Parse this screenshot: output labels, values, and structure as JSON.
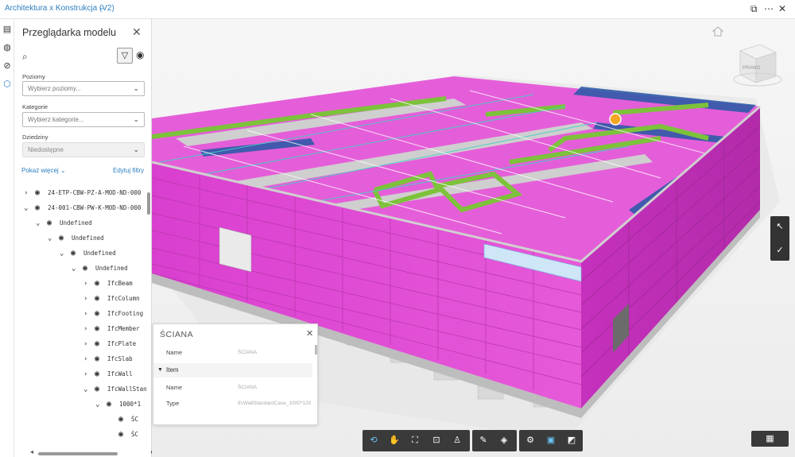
{
  "topbar": {
    "project_title": "Architektura x Konstrukcja (V2)",
    "dropdown_icon": "chevron-down-icon",
    "icons": [
      "split-view-icon",
      "more-icon",
      "close-icon"
    ]
  },
  "left_rail": {
    "icons": [
      "model-browser-icon",
      "globe-icon",
      "issues-icon",
      "cube-icon"
    ]
  },
  "panel": {
    "title": "Przeglądarka modelu",
    "close_icon": "close-icon",
    "filters": [
      {
        "label": "Poziomy",
        "placeholder": "Wybierz poziomy..."
      },
      {
        "label": "Kategorie",
        "placeholder": "Wybierz kategorie..."
      },
      {
        "label": "Dziedziny",
        "placeholder": "Niedostępne"
      }
    ],
    "show_more": "Pokaż więcej",
    "edit_filters": "Edytuj filtry",
    "tree": [
      {
        "label": "24-ETP-CBW-PZ-A-MOD-ND-000",
        "indent": 0,
        "expander": "›"
      },
      {
        "label": "24-001-CBW-PW-K-MOD-ND-000",
        "indent": 0,
        "expander": "⌄"
      },
      {
        "label": "Undefined",
        "indent": 1,
        "expander": "⌄"
      },
      {
        "label": "Undefined",
        "indent": 2,
        "expander": "⌄"
      },
      {
        "label": "Undefined",
        "indent": 3,
        "expander": "⌄"
      },
      {
        "label": "Undefined",
        "indent": 4,
        "expander": "⌄"
      },
      {
        "label": "IfcBeam",
        "indent": 5,
        "expander": "›"
      },
      {
        "label": "IfcColumn",
        "indent": 5,
        "expander": "›"
      },
      {
        "label": "IfcFooting",
        "indent": 5,
        "expander": "›"
      },
      {
        "label": "IfcMember",
        "indent": 5,
        "expander": "›"
      },
      {
        "label": "IfcPlate",
        "indent": 5,
        "expander": "›"
      },
      {
        "label": "IfcSlab",
        "indent": 5,
        "expander": "›"
      },
      {
        "label": "IfcWall",
        "indent": 5,
        "expander": "›"
      },
      {
        "label": "IfcWallStan",
        "indent": 5,
        "expander": "⌄"
      },
      {
        "label": "1000*1",
        "indent": 6,
        "expander": "⌄"
      },
      {
        "label": "ŚC",
        "indent": 7,
        "expander": ""
      },
      {
        "label": "ŚC",
        "indent": 7,
        "expander": ""
      }
    ]
  },
  "properties": {
    "title": "ŚCIANA",
    "rows_top": [
      {
        "key": "Name",
        "value": "ŚCIANA"
      }
    ],
    "section": "Item",
    "rows_item": [
      {
        "key": "Name",
        "value": "ŚCIANA"
      },
      {
        "key": "Type",
        "value": "IfcWallStandardCase_1000*120"
      }
    ]
  },
  "viewcube": {
    "face_label": "PRAWO"
  },
  "toolbar": {
    "group1": [
      "orbit-icon",
      "pan-icon",
      "fit-to-view-icon",
      "zoom-window-icon",
      "first-person-icon"
    ],
    "group2": [
      "measure-icon",
      "section-icon"
    ],
    "group3": [
      "settings-icon",
      "model-browser-icon",
      "fullscreen-icon"
    ]
  },
  "right_tools": [
    "select-icon",
    "markup-check-icon"
  ],
  "colors": {
    "accent": "#2d7fc1",
    "wall_magenta": "#e34ad7",
    "beam_green": "#7dc23b",
    "steel_blue": "#2f5aa8",
    "marker_orange": "#f5a623"
  }
}
